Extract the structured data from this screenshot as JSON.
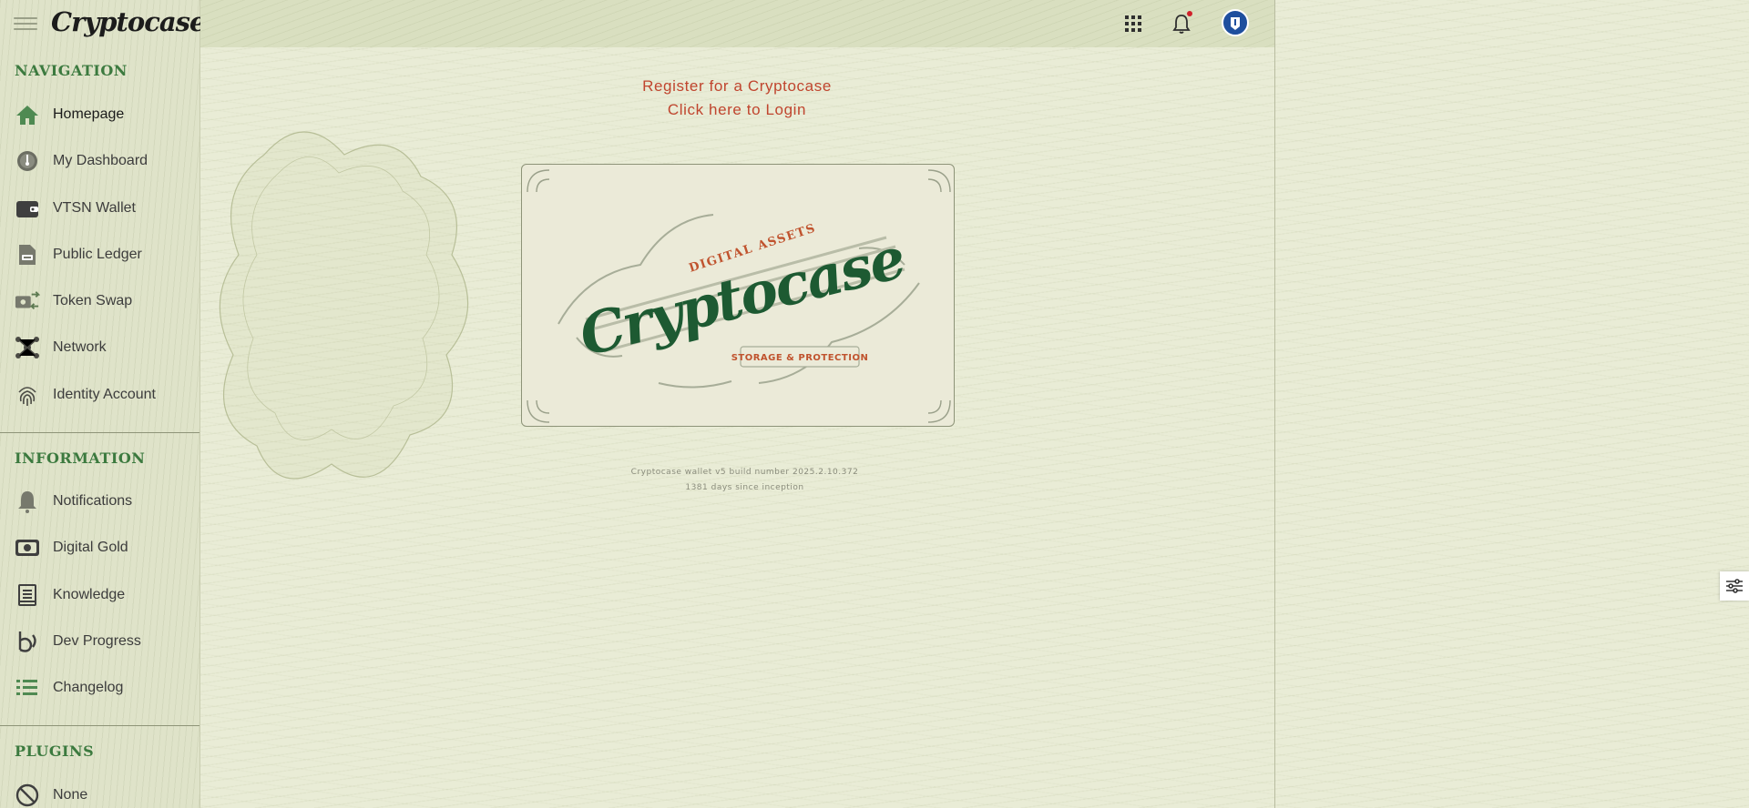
{
  "app": {
    "logo_text": "Cryptocase"
  },
  "sidebar": {
    "sections": [
      {
        "title": "NAVIGATION"
      },
      {
        "title": "INFORMATION"
      },
      {
        "title": "PLUGINS"
      }
    ],
    "navigation": [
      {
        "label": "Homepage",
        "icon": "home-icon"
      },
      {
        "label": "My Dashboard",
        "icon": "gauge-icon"
      },
      {
        "label": "VTSN Wallet",
        "icon": "wallet-icon"
      },
      {
        "label": "Public Ledger",
        "icon": "ledger-icon"
      },
      {
        "label": "Token Swap",
        "icon": "swap-icon"
      },
      {
        "label": "Network",
        "icon": "network-icon"
      },
      {
        "label": "Identity Account",
        "icon": "fingerprint-icon"
      }
    ],
    "information": [
      {
        "label": "Notifications",
        "icon": "bell-icon"
      },
      {
        "label": "Digital Gold",
        "icon": "money-icon"
      },
      {
        "label": "Knowledge",
        "icon": "book-icon"
      },
      {
        "label": "Dev Progress",
        "icon": "progress-icon"
      },
      {
        "label": "Changelog",
        "icon": "list-icon"
      }
    ],
    "plugins": [
      {
        "label": "None",
        "icon": "none-icon"
      }
    ]
  },
  "topbar": {
    "apps_icon": "grid-icon",
    "notifications_icon": "bell-icon",
    "avatar_icon": "avatar-icon"
  },
  "main": {
    "register_link": "Register for a Cryptocase",
    "login_link": "Click here to Login",
    "hero": {
      "top_text": "DIGITAL ASSETS",
      "logo_text": "Cryptocase",
      "bottom_text": "STORAGE & PROTECTION"
    },
    "build_line": "Cryptocase wallet v5 build number 2025.2.10.372",
    "days_line": "1381 days since inception"
  },
  "colors": {
    "accent_green": "#3c7a3f",
    "link_red": "#c0452e",
    "logo_green": "#1d5a32",
    "hero_orange": "#c0532e"
  }
}
